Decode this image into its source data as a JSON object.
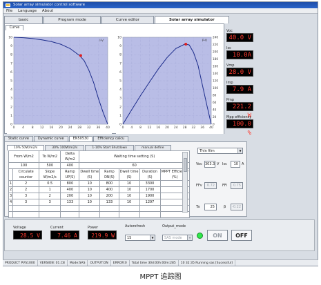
{
  "window": {
    "title": "Solar array simulator control software"
  },
  "menu": [
    "File",
    "Language",
    "About"
  ],
  "tabs": [
    {
      "label": "basic",
      "active": false
    },
    {
      "label": "Program mode",
      "active": false
    },
    {
      "label": "Curve editor",
      "active": false
    },
    {
      "label": "Solar array simulator",
      "active": true
    }
  ],
  "curve_tab": "Curve",
  "chart_data": [
    {
      "type": "line",
      "title": "",
      "legend": "I-V",
      "x": [
        0,
        4,
        8,
        12,
        16,
        20,
        24,
        28,
        32,
        36,
        40
      ],
      "xticks": [
        "0",
        "4",
        "8",
        "12",
        "16",
        "20",
        "24",
        "28",
        "32",
        "36",
        "40"
      ],
      "yticks": [
        "0",
        "1",
        "2",
        "3",
        "4",
        "5",
        "6",
        "7",
        "8",
        "9",
        "10"
      ],
      "xlim": [
        0,
        40
      ],
      "ylim": [
        0,
        10
      ],
      "series": [
        {
          "x": [
            0,
            4,
            8,
            12,
            16,
            20,
            24,
            28,
            30,
            32,
            34,
            36,
            38,
            40
          ],
          "y": [
            10.0,
            9.95,
            9.85,
            9.7,
            9.5,
            9.2,
            8.7,
            7.9,
            7.3,
            6.2,
            4.8,
            3.0,
            1.4,
            0
          ]
        }
      ],
      "marker": {
        "x": 28.5,
        "y": 7.9
      }
    },
    {
      "type": "line",
      "title": "",
      "legend": "P-V",
      "xticks": [
        "0",
        "4",
        "8",
        "12",
        "16",
        "20",
        "24",
        "28",
        "32",
        "36",
        "40"
      ],
      "yticks_left": [
        "0",
        "1",
        "2",
        "3",
        "4",
        "5",
        "6",
        "7",
        "8",
        "9",
        "10"
      ],
      "yticks_right": [
        "0",
        "20",
        "40",
        "60",
        "80",
        "100",
        "120",
        "140",
        "160",
        "180",
        "200",
        "220",
        "240"
      ],
      "xlim": [
        0,
        40
      ],
      "ylim": [
        0,
        240
      ],
      "series": [
        {
          "x": [
            0,
            4,
            8,
            12,
            16,
            20,
            24,
            28,
            30,
            32,
            34,
            36,
            38,
            40
          ],
          "y": [
            0,
            40,
            79,
            116,
            152,
            184,
            209,
            221,
            219,
            198,
            163,
            108,
            53,
            0
          ]
        }
      ],
      "marker": {
        "x": 28.5,
        "y": 221
      }
    }
  ],
  "readouts": [
    {
      "label": "Voc",
      "value": "40.0 V"
    },
    {
      "label": "Isc",
      "value": "10.0A"
    },
    {
      "label": "Vmp",
      "value": "28.0 V"
    },
    {
      "label": "Imp",
      "value": "7.9 A"
    },
    {
      "label": "Pmp",
      "value": "221.2 W"
    },
    {
      "label": "Mpp efficiency",
      "value": "100.0 %"
    }
  ],
  "lower_tabs": [
    {
      "label": "Static curve",
      "active": false
    },
    {
      "label": "Dynamic curve",
      "active": false
    },
    {
      "label": "EN50530",
      "active": true
    },
    {
      "label": "Efficiency calcu",
      "active": false
    }
  ],
  "sub_tabs": [
    {
      "label": "10% 50W/m2/s",
      "active": true
    },
    {
      "label": "30% 100W/m2/s",
      "active": false
    },
    {
      "label": "1-10% Start Shutdown",
      "active": false
    },
    {
      "label": "manual define",
      "active": false
    }
  ],
  "table": {
    "head1": [
      "From W/m2",
      "To W/m2",
      "Delta W/m2",
      "Waiting time setting (S)"
    ],
    "head1_vals": [
      "100",
      "500",
      "400",
      "60"
    ],
    "head2": [
      "",
      "Circulate counter",
      "Slope W/m2/s",
      "Ramp UP(S)",
      "Dwell time (S)",
      "Ramp DN(S)",
      "Dwell time (S)",
      "Duration (S)",
      "MPPT Efficiency (%)"
    ],
    "rows": [
      [
        "1",
        "2",
        "0.5",
        "800",
        "10",
        "800",
        "10",
        "3300",
        ""
      ],
      [
        "2",
        "2",
        "1",
        "400",
        "10",
        "400",
        "10",
        "1700",
        ""
      ],
      [
        "3",
        "3",
        "2",
        "200",
        "10",
        "200",
        "10",
        "1900",
        ""
      ],
      [
        "4",
        "3",
        "3",
        "133",
        "10",
        "133",
        "10",
        "1297",
        ""
      ]
    ]
  },
  "side": {
    "module_type": "Thin film",
    "voc_label": "Voc",
    "voc_value": "303.3",
    "voc_unit": "V",
    "isc_label": "Isc",
    "isc_value": "10",
    "isc_unit": "A",
    "ffv_label": "FFv",
    "ffv_value": "0.72",
    "ffi_label": "FFi",
    "ffi_value": "0.75",
    "ta_label": "Ta",
    "ta_value": "25",
    "beta_label": "β",
    "beta_value": "-0.22"
  },
  "bottom": {
    "voltage_label": "Voltage",
    "voltage_value": "28.5 V",
    "current_label": "Current",
    "current_value": "7.46 A",
    "power_label": "Power",
    "power_value": "219.9 W",
    "autorefresh_label": "Autorefresh",
    "autorefresh_value": "1S",
    "output_mode_label": "Output_mode",
    "output_mode_value": "SAS mode",
    "on_label": "ON",
    "off_label": "OFF"
  },
  "status": [
    "PRODUCT PVS1000",
    "VERSION: 01.C8",
    "Mode:SAS",
    "OUTPUT:ON",
    "ERROR:0",
    "Total time 30d:00h:00m:285",
    "10 32:35 Running sas [Sucessful]"
  ],
  "caption": "MPPT 追踪图"
}
